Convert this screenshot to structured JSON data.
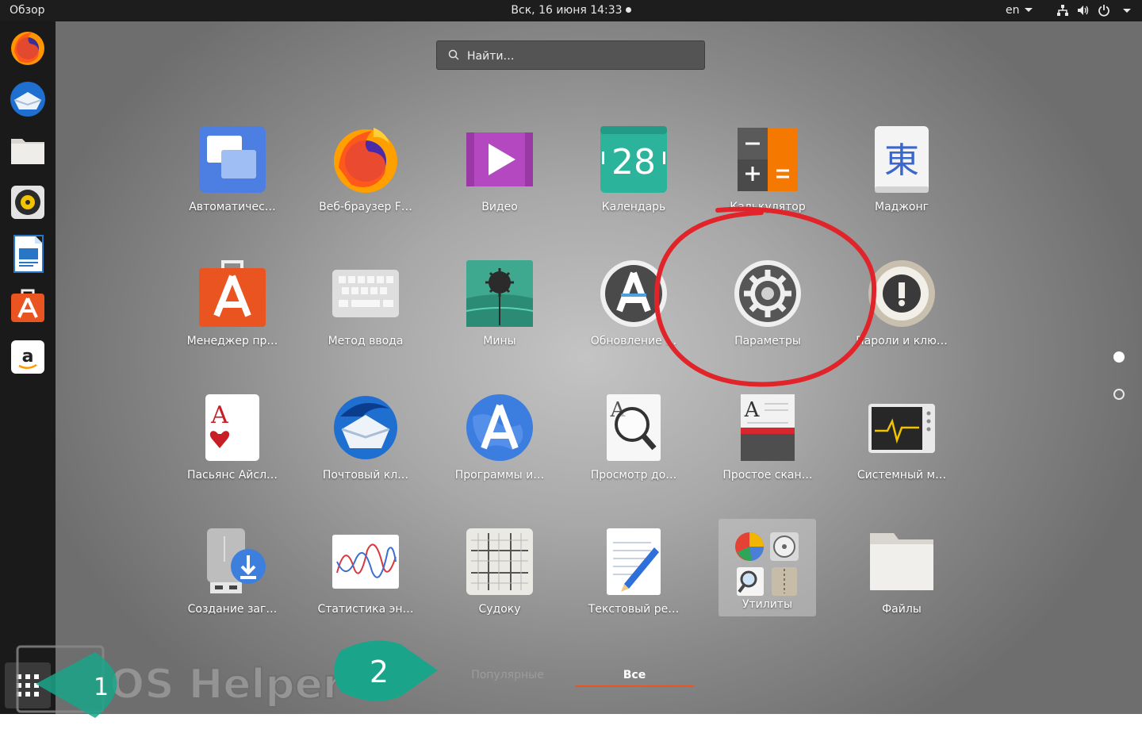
{
  "topbar": {
    "activities": "Обзор",
    "datetime": "Вск, 16 июня  14:33",
    "language": "en"
  },
  "search": {
    "placeholder": "Найти…"
  },
  "dock": {
    "items": [
      "firefox",
      "thunderbird",
      "files",
      "rhythmbox",
      "libreoffice-writer",
      "ubuntu-software",
      "amazon"
    ]
  },
  "apps": [
    {
      "label": "Автоматичес…",
      "icon": "window-icon"
    },
    {
      "label": "Веб-браузер F…",
      "icon": "firefox-icon"
    },
    {
      "label": "Видео",
      "icon": "video-icon"
    },
    {
      "label": "Календарь",
      "icon": "calendar-icon",
      "day": "28"
    },
    {
      "label": "Калькулятор",
      "icon": "calculator-icon"
    },
    {
      "label": "Маджонг",
      "icon": "mahjong-icon",
      "glyph": "東"
    },
    {
      "label": "Менеджер пр…",
      "icon": "software-icon"
    },
    {
      "label": "Метод ввода",
      "icon": "keyboard-icon"
    },
    {
      "label": "Мины",
      "icon": "mines-icon"
    },
    {
      "label": "Обновление …",
      "icon": "update-icon"
    },
    {
      "label": "Параметры",
      "icon": "settings-icon"
    },
    {
      "label": "Пароли и клю…",
      "icon": "passwords-icon"
    },
    {
      "label": "Пасьянс Айсл…",
      "icon": "solitaire-icon"
    },
    {
      "label": "Почтовый кл…",
      "icon": "thunderbird-icon"
    },
    {
      "label": "Программы и…",
      "icon": "software-properties-icon"
    },
    {
      "label": "Просмотр до…",
      "icon": "document-viewer-icon"
    },
    {
      "label": "Простое скан…",
      "icon": "scanner-icon"
    },
    {
      "label": "Системный м…",
      "icon": "system-monitor-icon"
    },
    {
      "label": "Создание заг…",
      "icon": "usb-creator-icon"
    },
    {
      "label": "Статистика эн…",
      "icon": "power-stats-icon"
    },
    {
      "label": "Судоку",
      "icon": "sudoku-icon"
    },
    {
      "label": "Текстовый ре…",
      "icon": "text-editor-icon"
    },
    {
      "label": "Утилиты",
      "icon": "utilities-folder-icon"
    },
    {
      "label": "Файлы",
      "icon": "files-icon"
    }
  ],
  "tabs": {
    "frequent": "Популярные",
    "all": "Все"
  },
  "annotations": {
    "step1": "1",
    "step2": "2",
    "watermark": "OS Helper"
  },
  "colors": {
    "accent": "#e95420",
    "annotation_green": "#1aa58a",
    "annotation_circle": "#e0242a"
  }
}
